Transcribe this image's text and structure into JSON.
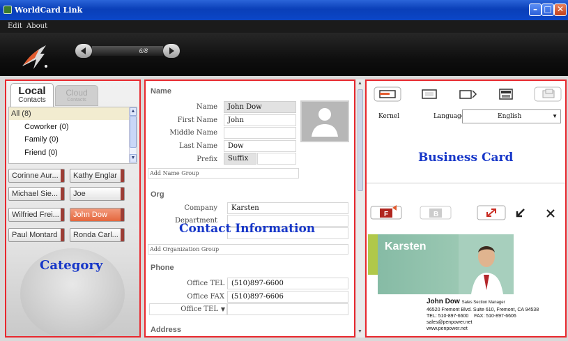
{
  "window": {
    "title": "WorldCard Link"
  },
  "menu": {
    "items": [
      "Edit",
      "About"
    ]
  },
  "pager": {
    "text": "6/8"
  },
  "category": {
    "tab_local": "Local",
    "tab_local_sub": "Contacts",
    "tab_cloud": "Cloud",
    "tab_cloud_sub": "Contacts",
    "groups": [
      "All  (8)",
      "Coworker  (0)",
      "Family  (0)",
      "Friend  (0)"
    ],
    "contacts": [
      "Corinne Aur...",
      "Kathy Englar",
      "Michael Sie...",
      "Joe",
      "Wilfried Frei...",
      "John Dow",
      "Paul Montard",
      "Ronda Carl..."
    ],
    "overlay_label": "Category"
  },
  "contact": {
    "overlay_label": "Contact Information",
    "sections": {
      "name": "Name",
      "org": "Org",
      "phone": "Phone",
      "address": "Address"
    },
    "name_fields": {
      "name_label": "Name",
      "name_value": "John Dow",
      "first_label": "First Name",
      "first_value": "John",
      "middle_label": "Middle Name",
      "middle_value": "",
      "last_label": "Last Name",
      "last_value": "Dow",
      "prefix_label": "Prefix",
      "suffix_label": "Suffix",
      "group": "Add Name Group"
    },
    "org_fields": {
      "company_label": "Company",
      "company_value": "Karsten",
      "department_label": "Department",
      "department_value": "",
      "group": "Add Organization Group"
    },
    "phone_fields": {
      "tel_label": "Office TEL",
      "tel_value": "(510)897-6600",
      "fax_label": "Office FAX",
      "fax_value": "(510)897-6606",
      "new_label": "Office TEL"
    }
  },
  "business_card": {
    "overlay_label": "Business Card",
    "kernel_label": "Kernel",
    "language_label": "Language",
    "language_value": "English",
    "card": {
      "company": "Karsten",
      "name": "John Dow",
      "title": "Sales Section Manager",
      "address": "46520 Fremont Blvd. Suite 610, Fremont, CA 94538",
      "tel": "TEL: 510-897-6600",
      "fax": "FAX: 510-897-6606",
      "email": "sales@penpower.net",
      "web": "www.penpower.net"
    }
  },
  "colors": {
    "accent": "#e8282e",
    "label": "#1636c8",
    "cardbar": "#b0c84a",
    "cardbg": "#7fb39b"
  }
}
